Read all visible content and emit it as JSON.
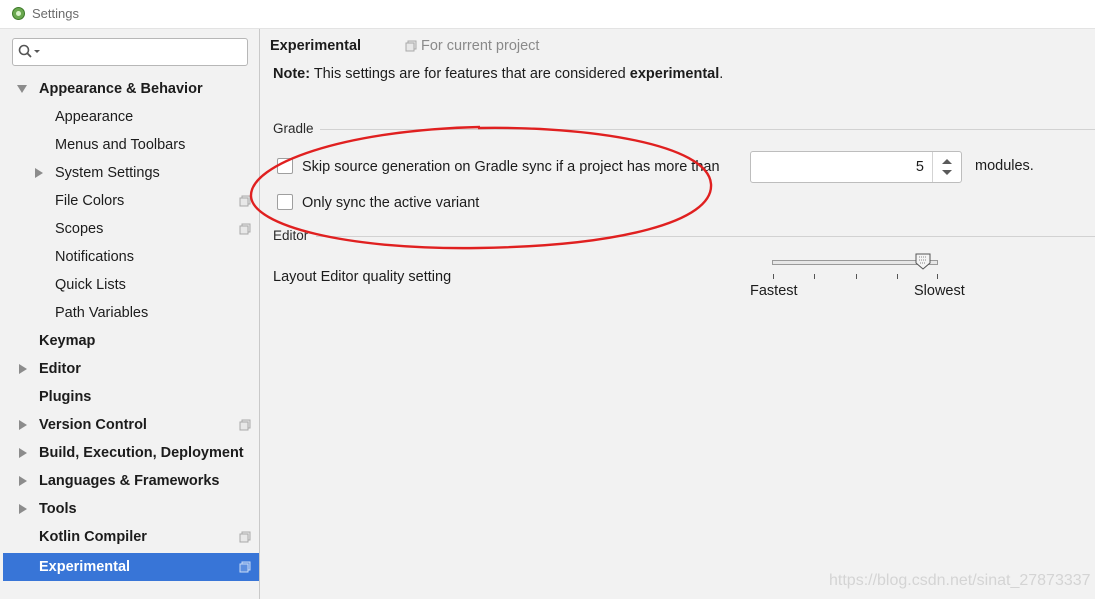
{
  "window": {
    "title": "Settings"
  },
  "sidebar": {
    "search": {
      "placeholder": ""
    },
    "items": [
      {
        "label": "Appearance & Behavior"
      },
      {
        "label": "Appearance"
      },
      {
        "label": "Menus and Toolbars"
      },
      {
        "label": "System Settings"
      },
      {
        "label": "File Colors"
      },
      {
        "label": "Scopes"
      },
      {
        "label": "Notifications"
      },
      {
        "label": "Quick Lists"
      },
      {
        "label": "Path Variables"
      },
      {
        "label": "Keymap"
      },
      {
        "label": "Editor"
      },
      {
        "label": "Plugins"
      },
      {
        "label": "Version Control"
      },
      {
        "label": "Build, Execution, Deployment"
      },
      {
        "label": "Languages & Frameworks"
      },
      {
        "label": "Tools"
      },
      {
        "label": "Kotlin Compiler"
      },
      {
        "label": "Experimental"
      }
    ]
  },
  "main": {
    "breadcrumb": "Experimental",
    "for_project": "For current project",
    "note": {
      "prefix": "Note:",
      "text": " This settings are for features that are considered ",
      "emphasis": "experimental",
      "suffix": "."
    },
    "gradle": {
      "title": "Gradle",
      "skip_source_label": "Skip source generation on Gradle sync if a project has more than",
      "skip_source_checked": false,
      "modules_value": "5",
      "modules_suffix": "modules.",
      "only_sync_label": "Only sync the active variant",
      "only_sync_checked": false
    },
    "editor": {
      "title": "Editor",
      "quality_label": "Layout Editor quality setting",
      "slider_min_label": "Fastest",
      "slider_max_label": "Slowest",
      "slider_level": 0.9
    }
  },
  "colors": {
    "selection": "#3875d7",
    "annotation": "#e02020",
    "background": "#f2f2f2"
  },
  "watermark": "https://blog.csdn.net/sinat_27873337"
}
